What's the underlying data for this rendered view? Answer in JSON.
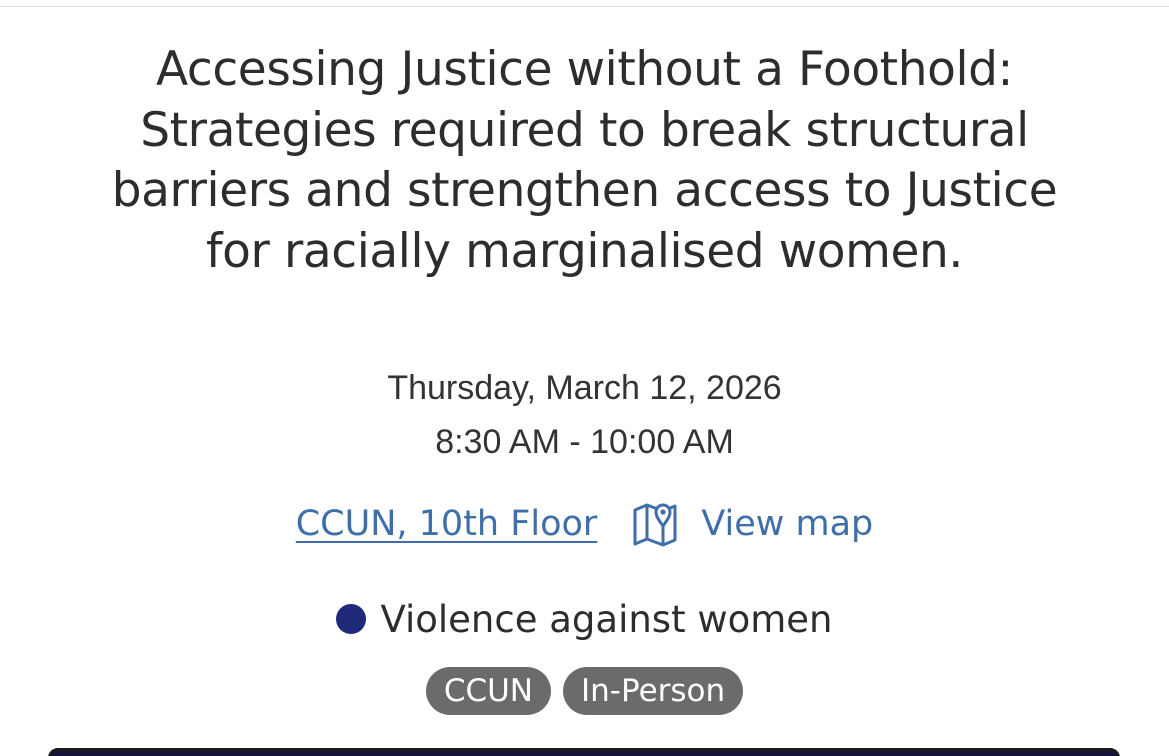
{
  "event": {
    "title": "Accessing Justice without a Foothold: Strategies required to break structural barriers and strengthen access to Justice for racially marginalised women.",
    "date": "Thursday, March 12, 2026",
    "time": "8:30 AM - 10:00 AM",
    "location": {
      "label": "CCUN, 10th Floor",
      "map_label": "View map",
      "map_icon": "map-pin-icon"
    },
    "category": {
      "label": "Violence against women",
      "color": "#1f2a7a"
    },
    "tags": [
      "CCUN",
      "In-Person"
    ]
  },
  "colors": {
    "link": "#3f6fa8",
    "tag_background": "#6b6b6b"
  }
}
